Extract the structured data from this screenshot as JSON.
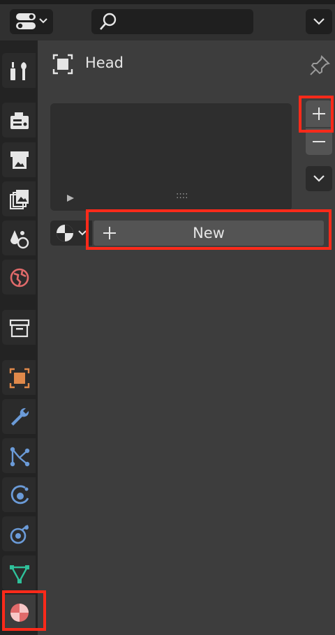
{
  "header": {
    "editor_type_icon": "properties-editor-icon",
    "search_placeholder": "",
    "dropdown_icon": "chevron-down-icon"
  },
  "sidebar": {
    "tabs": [
      {
        "name": "tool",
        "icon": "tool-icon"
      },
      {
        "name": "render",
        "icon": "render-icon"
      },
      {
        "name": "output",
        "icon": "output-icon"
      },
      {
        "name": "view-layer",
        "icon": "view-layer-icon"
      },
      {
        "name": "scene",
        "icon": "scene-icon"
      },
      {
        "name": "world",
        "icon": "world-icon"
      },
      {
        "name": "collection",
        "icon": "collection-icon"
      },
      {
        "name": "object",
        "icon": "object-icon"
      },
      {
        "name": "modifiers",
        "icon": "wrench-icon"
      },
      {
        "name": "particles",
        "icon": "particles-icon"
      },
      {
        "name": "physics",
        "icon": "physics-icon"
      },
      {
        "name": "constraints",
        "icon": "constraints-icon"
      },
      {
        "name": "data",
        "icon": "mesh-data-icon"
      },
      {
        "name": "material",
        "icon": "material-icon",
        "active": true
      }
    ]
  },
  "panel": {
    "object_name": "Head",
    "new_button_label": "New",
    "preview_handle": "::::"
  },
  "colors": {
    "highlight": "#ff2a1a",
    "material_accent": "#e06a6a",
    "object_accent": "#e0894a",
    "blue_accent": "#6b9bd8",
    "green_accent": "#2fc09a"
  }
}
